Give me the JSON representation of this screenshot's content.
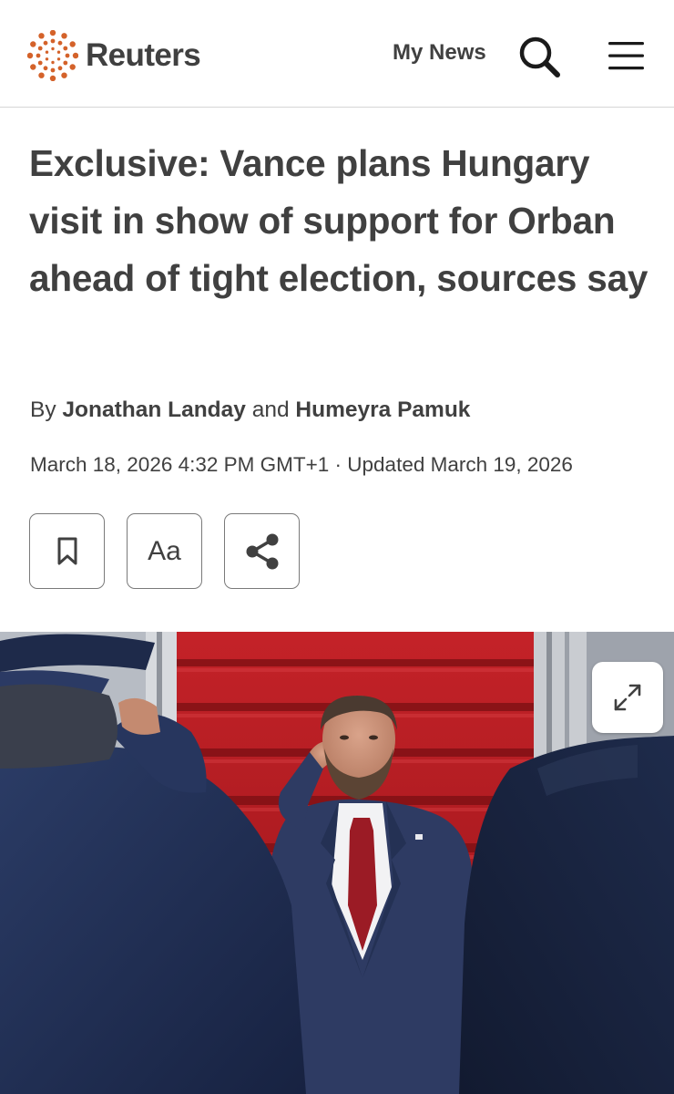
{
  "header": {
    "logo_text": "Reuters",
    "my_news_label": "My News",
    "search_icon": "search-icon",
    "menu_icon": "hamburger-menu-icon"
  },
  "article": {
    "headline": "Exclusive: Vance plans Hungary visit in show of support for Orban ahead of tight election, sources say",
    "byline": {
      "prefix": "By",
      "author1": "Jonathan Landay",
      "connector": "and",
      "author2": "Humeyra Pamuk"
    },
    "dateline": "March 18, 2026 4:32 PM GMT+1 · Updated March 19, 2026"
  },
  "tools": {
    "bookmark_icon": "bookmark-icon",
    "text_size_label": "Aa",
    "share_icon": "share-icon"
  },
  "media": {
    "expand_icon": "expand-icon"
  },
  "colors": {
    "text": "#404040",
    "brand_orange": "#d4622a",
    "carpet_red": "#b51e24",
    "suit_navy": "#2a3556",
    "tie_red": "#9b1b25"
  }
}
